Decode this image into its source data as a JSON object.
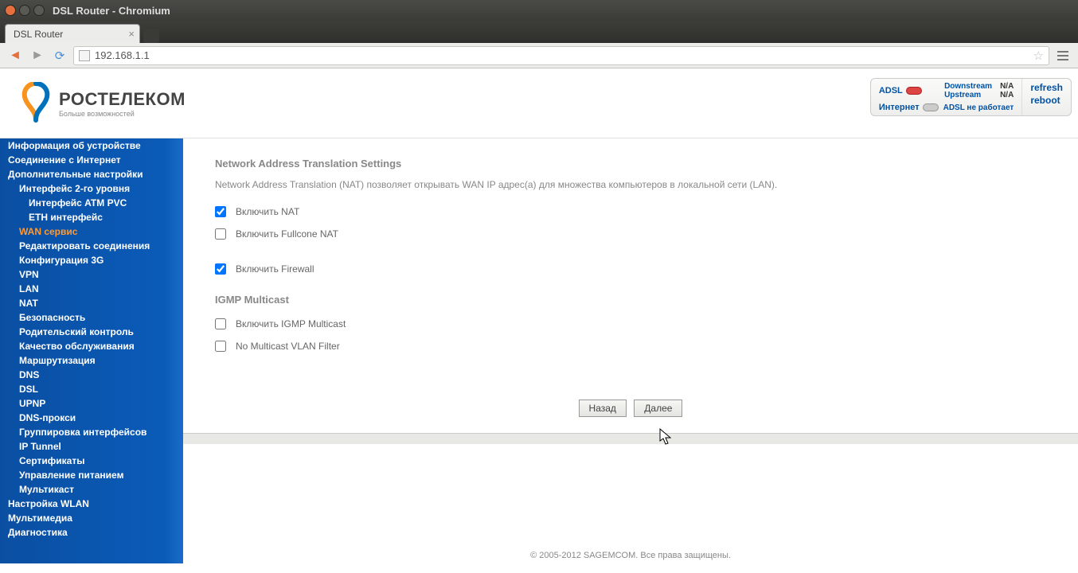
{
  "window": {
    "title": "DSL Router - Chromium"
  },
  "browser": {
    "tab_title": "DSL Router",
    "url": "192.168.1.1"
  },
  "logo": {
    "name": "РОСТЕЛЕКОМ",
    "tagline": "Больше возможностей"
  },
  "status": {
    "adsl_label": "ADSL",
    "internet_label": "Интернет",
    "downstream_label": "Downstream",
    "upstream_label": "Upstream",
    "downstream_val": "N/A",
    "upstream_val": "N/A",
    "adsl_error": "ADSL не работает",
    "refresh": "refresh",
    "reboot": "reboot"
  },
  "sidebar": {
    "items": [
      {
        "label": "Информация об устройстве",
        "indent": 0
      },
      {
        "label": "Соединение с Интернет",
        "indent": 0
      },
      {
        "label": "Дополнительные настройки",
        "indent": 0
      },
      {
        "label": "Интерфейс 2-го уровня",
        "indent": 1
      },
      {
        "label": "Интерфейс ATM PVC",
        "indent": 2
      },
      {
        "label": "ETH интерфейс",
        "indent": 2
      },
      {
        "label": "WAN сервис",
        "indent": 1,
        "active": true
      },
      {
        "label": "Редактировать соединения",
        "indent": 1
      },
      {
        "label": "Конфигурация 3G",
        "indent": 1
      },
      {
        "label": "VPN",
        "indent": 1
      },
      {
        "label": "LAN",
        "indent": 1
      },
      {
        "label": "NAT",
        "indent": 1
      },
      {
        "label": "Безопасность",
        "indent": 1
      },
      {
        "label": "Родительский контроль",
        "indent": 1
      },
      {
        "label": "Качество обслуживания",
        "indent": 1
      },
      {
        "label": "Маршрутизация",
        "indent": 1
      },
      {
        "label": "DNS",
        "indent": 1
      },
      {
        "label": "DSL",
        "indent": 1
      },
      {
        "label": "UPNP",
        "indent": 1
      },
      {
        "label": "DNS-прокси",
        "indent": 1
      },
      {
        "label": "Группировка интерфейсов",
        "indent": 1
      },
      {
        "label": "IP Tunnel",
        "indent": 1
      },
      {
        "label": "Сертификаты",
        "indent": 1
      },
      {
        "label": "Управление питанием",
        "indent": 1
      },
      {
        "label": "Мультикаст",
        "indent": 1
      },
      {
        "label": "Настройка WLAN",
        "indent": 0
      },
      {
        "label": "Мультимедиа",
        "indent": 0
      },
      {
        "label": "Диагностика",
        "indent": 0
      }
    ]
  },
  "content": {
    "nat_title": "Network Address Translation Settings",
    "nat_desc": "Network Address Translation (NAT) позволяет открывать WAN IP адрес(а) для множества компьютеров в локальной сети (LAN).",
    "checks": [
      {
        "label": "Включить NAT",
        "checked": true
      },
      {
        "label": "Включить Fullcone NAT",
        "checked": false
      },
      {
        "label": "Включить Firewall",
        "checked": true
      }
    ],
    "igmp_title": "IGMP Multicast",
    "igmp_checks": [
      {
        "label": "Включить IGMP Multicast",
        "checked": false
      },
      {
        "label": "No Multicast VLAN Filter",
        "checked": false
      }
    ],
    "btn_back": "Назад",
    "btn_next": "Далее"
  },
  "footer": "© 2005-2012 SAGEMCOM. Все права защищены."
}
